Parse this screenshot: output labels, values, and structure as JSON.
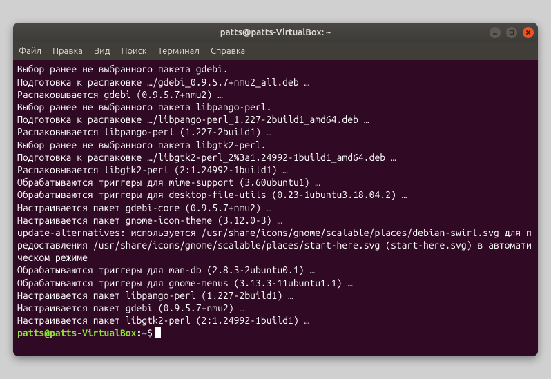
{
  "titlebar": {
    "title": "patts@patts-VirtualBox: ~"
  },
  "menubar": {
    "items": [
      {
        "label": "Файл"
      },
      {
        "label": "Правка"
      },
      {
        "label": "Вид"
      },
      {
        "label": "Поиск"
      },
      {
        "label": "Терминал"
      },
      {
        "label": "Справка"
      }
    ]
  },
  "terminal": {
    "lines": [
      "Выбор ранее не выбранного пакета gdebi.",
      "Подготовка к распаковке …/gdebi_0.9.5.7+nmu2_all.deb …",
      "Распаковывается gdebi (0.9.5.7+nmu2) …",
      "Выбор ранее не выбранного пакета libpango-perl.",
      "Подготовка к распаковке …/libpango-perl_1.227-2build1_amd64.deb …",
      "Распаковывается libpango-perl (1.227-2build1) …",
      "Выбор ранее не выбранного пакета libgtk2-perl.",
      "Подготовка к распаковке …/libgtk2-perl_2%3a1.24992-1build1_amd64.deb …",
      "Распаковывается libgtk2-perl (2:1.24992-1build1) …",
      "Обрабатываются триггеры для mime-support (3.60ubuntu1) …",
      "Обрабатываются триггеры для desktop-file-utils (0.23-1ubuntu3.18.04.2) …",
      "Настраивается пакет gdebi-core (0.9.5.7+nmu2) …",
      "Настраивается пакет gnome-icon-theme (3.12.0-3) …",
      "update-alternatives: используется /usr/share/icons/gnome/scalable/places/debian-swirl.svg для предоставления /usr/share/icons/gnome/scalable/places/start-here.svg (start-here.svg) в автоматическом режиме",
      "Обрабатываются триггеры для man-db (2.8.3-2ubuntu0.1) …",
      "Обрабатываются триггеры для gnome-menus (3.13.3-11ubuntu1.1) …",
      "Настраивается пакет libpango-perl (1.227-2build1) …",
      "Настраивается пакет gdebi (0.9.5.7+nmu2) …",
      "Настраивается пакет libgtk2-perl (2:1.24992-1build1) …"
    ],
    "prompt": {
      "user_host": "patts@patts-VirtualBox",
      "colon": ":",
      "path": "~",
      "dollar": "$"
    }
  }
}
